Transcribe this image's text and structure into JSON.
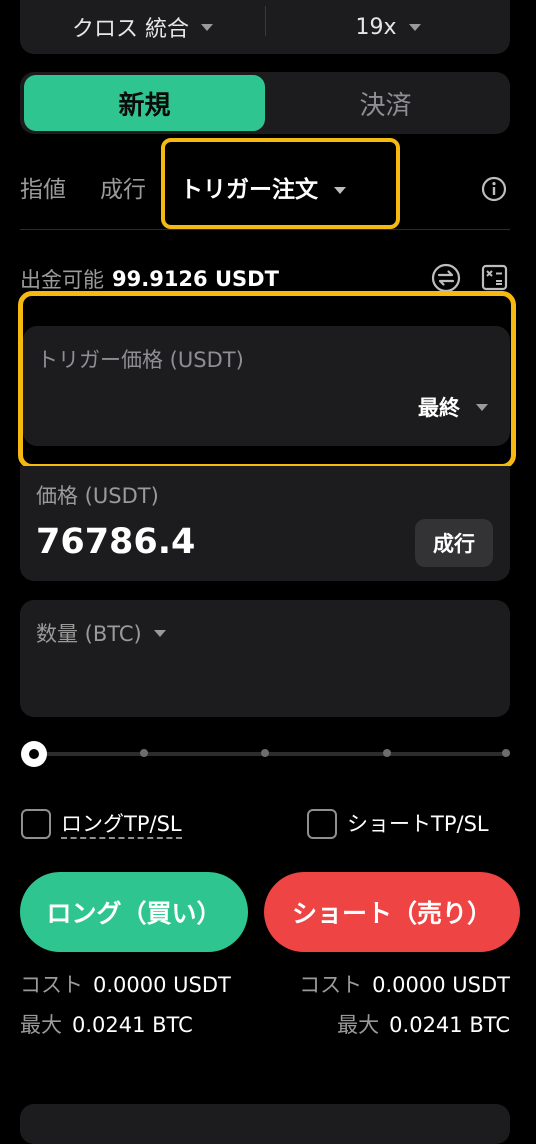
{
  "header": {
    "margin_mode": "クロス 統合",
    "leverage": "19x"
  },
  "mode_tabs": {
    "open": "新規",
    "close": "決済"
  },
  "order_tabs": {
    "limit": "指値",
    "market": "成行",
    "trigger": "トリガー注文"
  },
  "available": {
    "label": "出金可能",
    "value": "99.9126 USDT"
  },
  "trigger_price": {
    "placeholder": "トリガー価格 (USDT)",
    "reference": "最終"
  },
  "price": {
    "label": "価格 (USDT)",
    "value": "76786.4",
    "market_button": "成行"
  },
  "quantity": {
    "label": "数量 (BTC)"
  },
  "slider": {
    "value_percent": 0
  },
  "tpsl": {
    "long_label": "ロングTP/SL",
    "short_label": "ショートTP/SL",
    "long_checked": false,
    "short_checked": false
  },
  "actions": {
    "long": "ロング（買い）",
    "short": "ショート（売り）"
  },
  "long_info": {
    "cost_label": "コスト",
    "cost_value": "0.0000 USDT",
    "max_label": "最大",
    "max_value": "0.0241 BTC"
  },
  "short_info": {
    "cost_label": "コスト",
    "cost_value": "0.0000 USDT",
    "max_label": "最大",
    "max_value": "0.0241 BTC"
  },
  "colors": {
    "long": "#2fc591",
    "short": "#ee4444",
    "highlight": "#f5b90f",
    "panel": "#1c1c1e"
  },
  "icons": [
    "chevron-down-icon",
    "info-icon",
    "transfer-icon",
    "calculator-icon"
  ]
}
